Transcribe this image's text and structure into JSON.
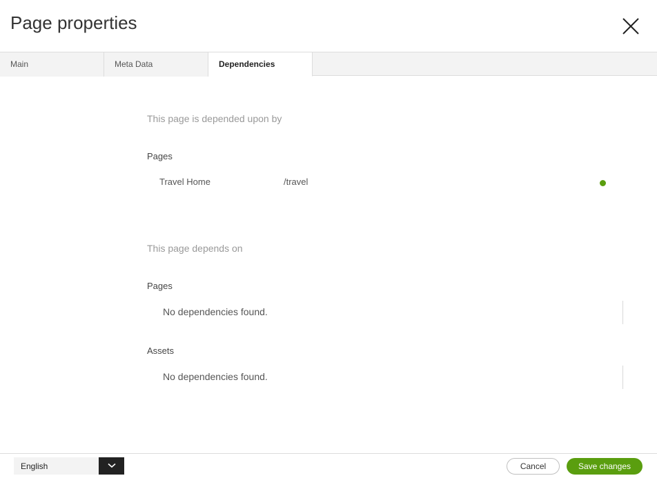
{
  "dialog": {
    "title": "Page properties",
    "close_icon": "close-icon"
  },
  "tabs": [
    {
      "label": "Main",
      "active": false
    },
    {
      "label": "Meta Data",
      "active": false
    },
    {
      "label": "Dependencies",
      "active": true
    }
  ],
  "depended_upon_by": {
    "heading": "This page is depended upon by",
    "groups": [
      {
        "label": "Pages",
        "items": [
          {
            "name": "Travel Home",
            "path": "/travel",
            "status_color": "#5a9e0f"
          }
        ]
      }
    ]
  },
  "depends_on": {
    "heading": "This page depends on",
    "groups": [
      {
        "label": "Pages",
        "empty_message": "No dependencies found."
      },
      {
        "label": "Assets",
        "empty_message": "No dependencies found."
      }
    ]
  },
  "footer": {
    "language": {
      "selected": "English",
      "icon": "chevron-down-icon"
    },
    "cancel_label": "Cancel",
    "save_label": "Save changes"
  },
  "colors": {
    "accent": "#5a9e0f",
    "dark": "#222222",
    "tab_bg": "#f3f3f3"
  }
}
